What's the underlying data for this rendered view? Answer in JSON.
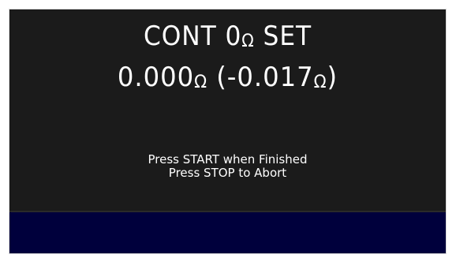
{
  "display": {
    "title_text": "CONT 0",
    "title_unit": "Ω",
    "title_suffix": " SET",
    "reading_value": "0.000",
    "reading_unit": "Ω",
    "offset_prefix": " (-0.017",
    "offset_unit": "Ω",
    "offset_suffix": ")",
    "instruction_start": "Press START when Finished",
    "instruction_stop": "Press STOP to Abort"
  },
  "colors": {
    "screen_bg": "#1b1b1b",
    "status_bar_bg": "#00003c",
    "text": "#ffffff"
  }
}
